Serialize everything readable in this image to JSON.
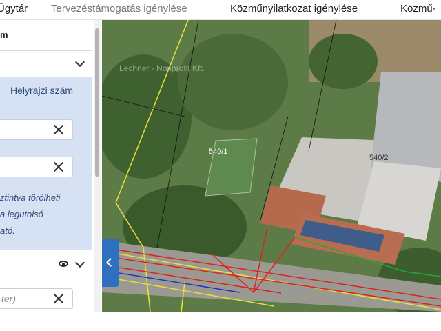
{
  "nav": {
    "items": [
      {
        "label": "Ügytár"
      },
      {
        "label": "Tervezéstámogatás igénylése"
      },
      {
        "label": "Közműnyilatkozat igénylése"
      },
      {
        "label": "Közmű-"
      }
    ]
  },
  "panel": {
    "title": "m",
    "hrsz_label": "Helyrajzi szám",
    "note_lines": [
      "ztintva törölheti",
      "a legutolsó",
      "ató."
    ],
    "search_placeholder": "ter)"
  },
  "map": {
    "parcel_labels": [
      "540/1",
      "540/2"
    ],
    "watermark": "Lechner - Nonprofit Kft."
  },
  "colors": {
    "accent": "#2f6fc0",
    "panel_bg": "#d6e2f3",
    "utility_red": "#e02020",
    "utility_yellow": "#e8e23a",
    "utility_blue": "#2233cc",
    "utility_green": "#22aa33"
  }
}
